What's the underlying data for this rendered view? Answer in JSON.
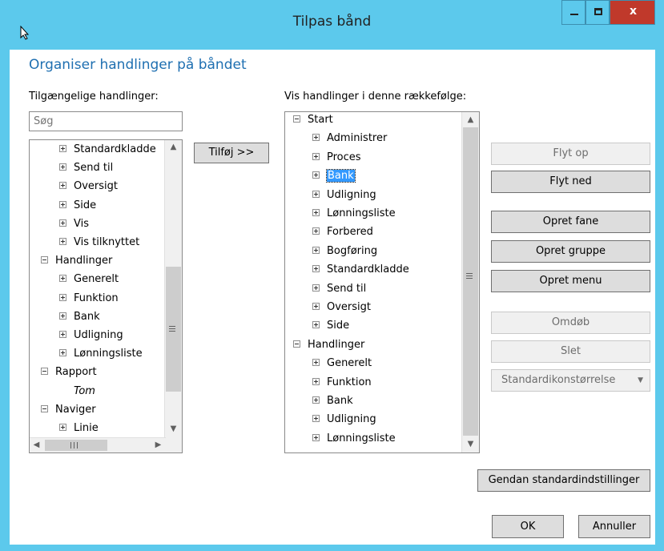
{
  "window": {
    "title": "Tilpas bånd"
  },
  "heading": "Organiser handlinger på båndet",
  "available": {
    "label": "Tilgængelige handlinger:",
    "search_placeholder": "Søg",
    "items": [
      {
        "text": "Standardkladde",
        "kind": "plus",
        "level": 1
      },
      {
        "text": "Send til",
        "kind": "plus",
        "level": 1
      },
      {
        "text": "Oversigt",
        "kind": "plus",
        "level": 1
      },
      {
        "text": "Side",
        "kind": "plus",
        "level": 1
      },
      {
        "text": "Vis",
        "kind": "plus",
        "level": 1
      },
      {
        "text": "Vis tilknyttet",
        "kind": "plus",
        "level": 1
      },
      {
        "text": "Handlinger",
        "kind": "minus",
        "level": 0
      },
      {
        "text": "Generelt",
        "kind": "plus",
        "level": 1
      },
      {
        "text": "Funktion",
        "kind": "plus",
        "level": 1
      },
      {
        "text": "Bank",
        "kind": "plus",
        "level": 1
      },
      {
        "text": "Udligning",
        "kind": "plus",
        "level": 1
      },
      {
        "text": "Lønningsliste",
        "kind": "plus",
        "level": 1
      },
      {
        "text": "Rapport",
        "kind": "minus",
        "level": 0
      },
      {
        "text": "Tom",
        "kind": "none",
        "level": 1,
        "italic": true
      },
      {
        "text": "Naviger",
        "kind": "minus",
        "level": 0
      },
      {
        "text": "Linie",
        "kind": "plus",
        "level": 1
      }
    ]
  },
  "add_button": "Tilføj >>",
  "order": {
    "label": "Vis handlinger i denne rækkefølge:",
    "items": [
      {
        "text": "Start",
        "kind": "minus",
        "level": 0
      },
      {
        "text": "Administrer",
        "kind": "plus",
        "level": 1
      },
      {
        "text": "Proces",
        "kind": "plus",
        "level": 1
      },
      {
        "text": "Bank",
        "kind": "plus",
        "level": 1,
        "selected": true
      },
      {
        "text": "Udligning",
        "kind": "plus",
        "level": 1
      },
      {
        "text": "Lønningsliste",
        "kind": "plus",
        "level": 1
      },
      {
        "text": "Forbered",
        "kind": "plus",
        "level": 1
      },
      {
        "text": "Bogføring",
        "kind": "plus",
        "level": 1
      },
      {
        "text": "Standardkladde",
        "kind": "plus",
        "level": 1
      },
      {
        "text": "Send til",
        "kind": "plus",
        "level": 1
      },
      {
        "text": "Oversigt",
        "kind": "plus",
        "level": 1
      },
      {
        "text": "Side",
        "kind": "plus",
        "level": 1
      },
      {
        "text": "Handlinger",
        "kind": "minus",
        "level": 0
      },
      {
        "text": "Generelt",
        "kind": "plus",
        "level": 1
      },
      {
        "text": "Funktion",
        "kind": "plus",
        "level": 1
      },
      {
        "text": "Bank",
        "kind": "plus",
        "level": 1
      },
      {
        "text": "Udligning",
        "kind": "plus",
        "level": 1
      },
      {
        "text": "Lønningsliste",
        "kind": "plus",
        "level": 1
      }
    ]
  },
  "buttons": {
    "move_up": "Flyt op",
    "move_down": "Flyt ned",
    "create_tab": "Opret fane",
    "create_group": "Opret gruppe",
    "create_menu": "Opret menu",
    "rename": "Omdøb",
    "delete": "Slet",
    "icon_size": "Standardikonstørrelse",
    "restore": "Gendan standardindstillinger",
    "ok": "OK",
    "cancel": "Annuller"
  },
  "colors": {
    "titlebar": "#5cc9ec",
    "heading": "#1e6fb1",
    "close": "#c0392b",
    "selection": "#3399ff"
  }
}
